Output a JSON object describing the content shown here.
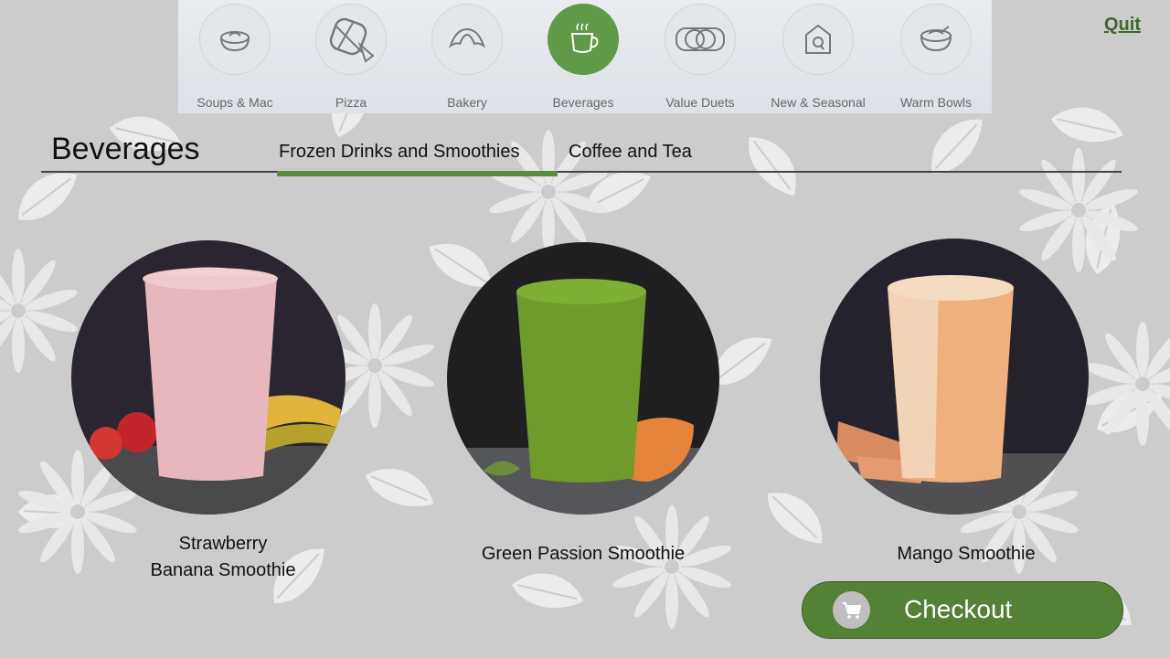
{
  "nav": {
    "categories": [
      {
        "label": "Soups & Mac",
        "icon": "bowl-icon"
      },
      {
        "label": "Pizza",
        "icon": "pizza-icon"
      },
      {
        "label": "Bakery",
        "icon": "croissant-icon"
      },
      {
        "label": "Beverages",
        "icon": "cup-icon",
        "active": true
      },
      {
        "label": "Value Duets",
        "icon": "rings-icon"
      },
      {
        "label": "New & Seasonal",
        "icon": "house-icon"
      },
      {
        "label": "Warm Bowls",
        "icon": "warm-bowl-icon"
      }
    ],
    "quit_label": "Quit"
  },
  "header": {
    "title": "Beverages",
    "tabs": [
      {
        "label": "Frozen Drinks and Smoothies",
        "active": true
      },
      {
        "label": "Coffee and Tea"
      }
    ]
  },
  "products": [
    {
      "name_line1": "Strawberry",
      "name_line2": "Banana Smoothie"
    },
    {
      "name": "Green Passion Smoothie"
    },
    {
      "name": "Mango Smoothie"
    }
  ],
  "checkout": {
    "label": "Checkout",
    "icon": "cart-icon"
  },
  "colors": {
    "accent": "#538135",
    "active_circle": "#5f9a48",
    "quit": "#3b6a2c"
  }
}
